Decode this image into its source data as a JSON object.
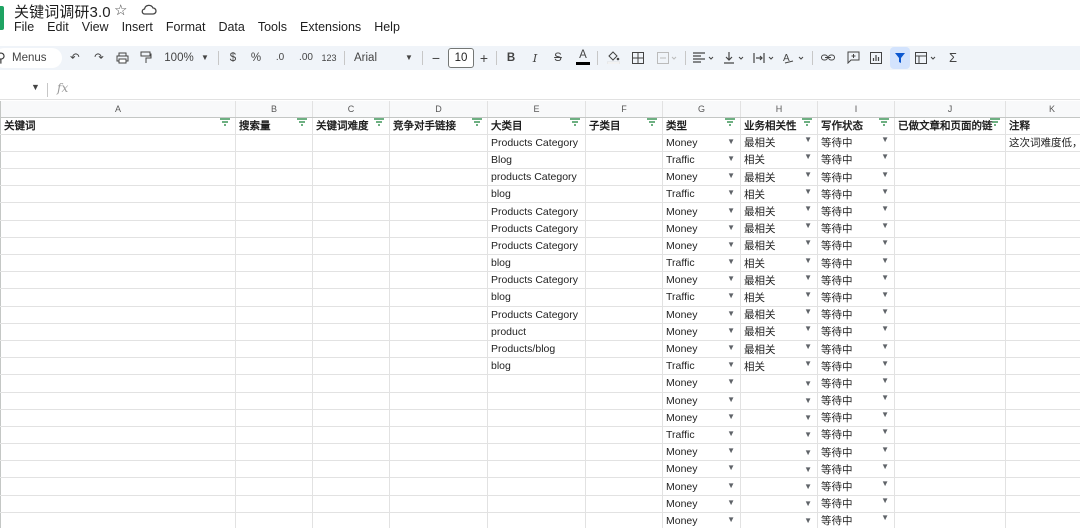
{
  "doc": {
    "title": "关键词调研3.0",
    "menus": [
      "File",
      "Edit",
      "View",
      "Insert",
      "Format",
      "Data",
      "Tools",
      "Extensions",
      "Help"
    ]
  },
  "toolbar": {
    "menus_label": "Menus",
    "zoom": "100%",
    "currency": "$",
    "percent": "%",
    "decrease_decimal": ".0",
    "increase_decimal": ".00",
    "number_format": "123",
    "font": "Arial",
    "font_size": "10",
    "bold": "B",
    "italic": "I",
    "strike": "S",
    "text_color": "A",
    "sigma": "Σ"
  },
  "colors": {
    "filter_green": "#188038",
    "header_bg": "#f8f9fa",
    "brand": "#1ea362",
    "toolbar_bg": "#f0f4f9"
  },
  "sheet": {
    "columns": [
      "A",
      "B",
      "C",
      "D",
      "E",
      "F",
      "G",
      "H",
      "I",
      "J",
      "K"
    ],
    "headers": [
      "关键词",
      "搜索量",
      "关键词难度",
      "竞争对手链接",
      "大类目",
      "子类目",
      "类型",
      "业务相关性",
      "写作状态",
      "已做文章和页面的链",
      "注释"
    ],
    "rows": [
      {
        "E": "Products Category",
        "G": "Money",
        "H": "最相关",
        "I": "等待中",
        "K": "这次词难度低，"
      },
      {
        "E": "Blog",
        "G": "Traffic",
        "H": "相关",
        "I": "等待中"
      },
      {
        "E": "products Category",
        "G": "Money",
        "H": "最相关",
        "I": "等待中"
      },
      {
        "E": "blog",
        "G": "Traffic",
        "H": "相关",
        "I": "等待中"
      },
      {
        "E": "Products Category",
        "G": "Money",
        "H": "最相关",
        "I": "等待中"
      },
      {
        "E": "Products Category",
        "G": "Money",
        "H": "最相关",
        "I": "等待中"
      },
      {
        "E": "Products Category",
        "G": "Money",
        "H": "最相关",
        "I": "等待中"
      },
      {
        "E": "blog",
        "G": "Traffic",
        "H": "相关",
        "I": "等待中"
      },
      {
        "E": "Products Category",
        "G": "Money",
        "H": "最相关",
        "I": "等待中"
      },
      {
        "E": "blog",
        "G": "Traffic",
        "H": "相关",
        "I": "等待中"
      },
      {
        "E": "Products Category",
        "G": "Money",
        "H": "最相关",
        "I": "等待中"
      },
      {
        "E": "product",
        "G": "Money",
        "H": "最相关",
        "I": "等待中"
      },
      {
        "E": "Products/blog",
        "G": "Money",
        "H": "最相关",
        "I": "等待中"
      },
      {
        "E": "blog",
        "G": "Traffic",
        "H": "相关",
        "I": "等待中"
      },
      {
        "G": "Money",
        "I": "等待中"
      },
      {
        "G": "Money",
        "I": "等待中"
      },
      {
        "G": "Money",
        "I": "等待中"
      },
      {
        "G": "Traffic",
        "I": "等待中"
      },
      {
        "G": "Money",
        "I": "等待中"
      },
      {
        "G": "Money",
        "I": "等待中"
      },
      {
        "G": "Money",
        "I": "等待中"
      },
      {
        "G": "Money",
        "I": "等待中"
      },
      {
        "G": "Money",
        "I": "等待中"
      },
      {
        "G": "",
        "I": "等待中"
      }
    ],
    "dropdown_columns": [
      "G",
      "H",
      "I"
    ]
  }
}
